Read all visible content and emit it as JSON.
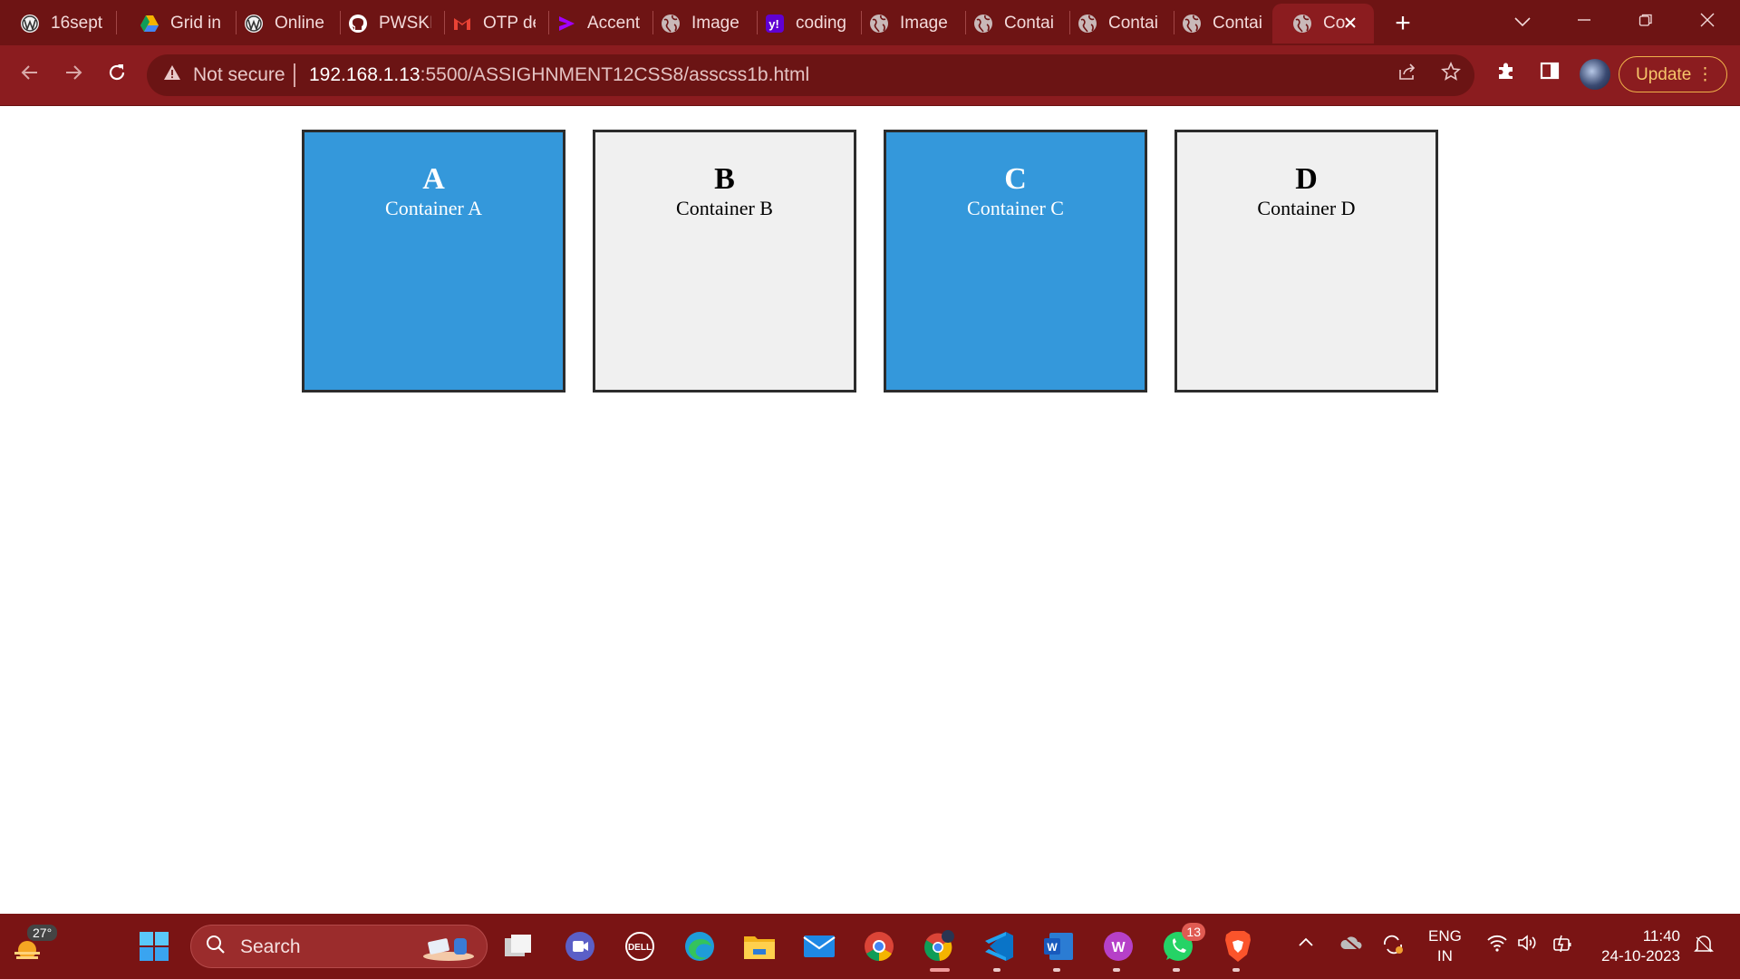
{
  "browser": {
    "tabs": [
      {
        "title": "16sept",
        "icon": "wordpress-icon"
      },
      {
        "title": "Grid in",
        "icon": "google-drive-icon"
      },
      {
        "title": "Online",
        "icon": "wordpress-icon"
      },
      {
        "title": "PWSKI",
        "icon": "github-icon"
      },
      {
        "title": "OTP de",
        "icon": "gmail-icon"
      },
      {
        "title": "Accent",
        "icon": "accenture-icon"
      },
      {
        "title": "Image",
        "icon": "globe-icon"
      },
      {
        "title": "coding",
        "icon": "yahoo-icon"
      },
      {
        "title": "Image",
        "icon": "globe-icon"
      },
      {
        "title": "Contai",
        "icon": "globe-icon"
      },
      {
        "title": "Contai",
        "icon": "globe-icon"
      },
      {
        "title": "Contai",
        "icon": "globe-icon"
      },
      {
        "title": "Co",
        "icon": "globe-icon",
        "active": true
      }
    ],
    "security_label": "Not secure",
    "url_host": "192.168.1.13",
    "url_rest": ":5500/ASSIGHNMENT12CSS8/asscss1b.html",
    "update_label": "Update"
  },
  "page": {
    "boxes": [
      {
        "letter": "A",
        "label": "Container A",
        "color": "#3498db"
      },
      {
        "letter": "B",
        "label": "Container B",
        "color": "#f0f0f0"
      },
      {
        "letter": "C",
        "label": "Container C",
        "color": "#3498db"
      },
      {
        "letter": "D",
        "label": "Container D",
        "color": "#f0f0f0"
      }
    ]
  },
  "taskbar": {
    "weather_temp": "27°",
    "search_label": "Search",
    "whatsapp_badge": "13",
    "lang_line1": "ENG",
    "lang_line2": "IN",
    "time": "11:40",
    "date": "24-10-2023"
  },
  "colors": {
    "tabstrip": "#6e1414",
    "toolbar": "#8b1c1f",
    "taskbar": "#7a1414",
    "blue_box": "#3498db",
    "grey_box": "#f0f0f0",
    "update_accent": "#f0b24a"
  }
}
